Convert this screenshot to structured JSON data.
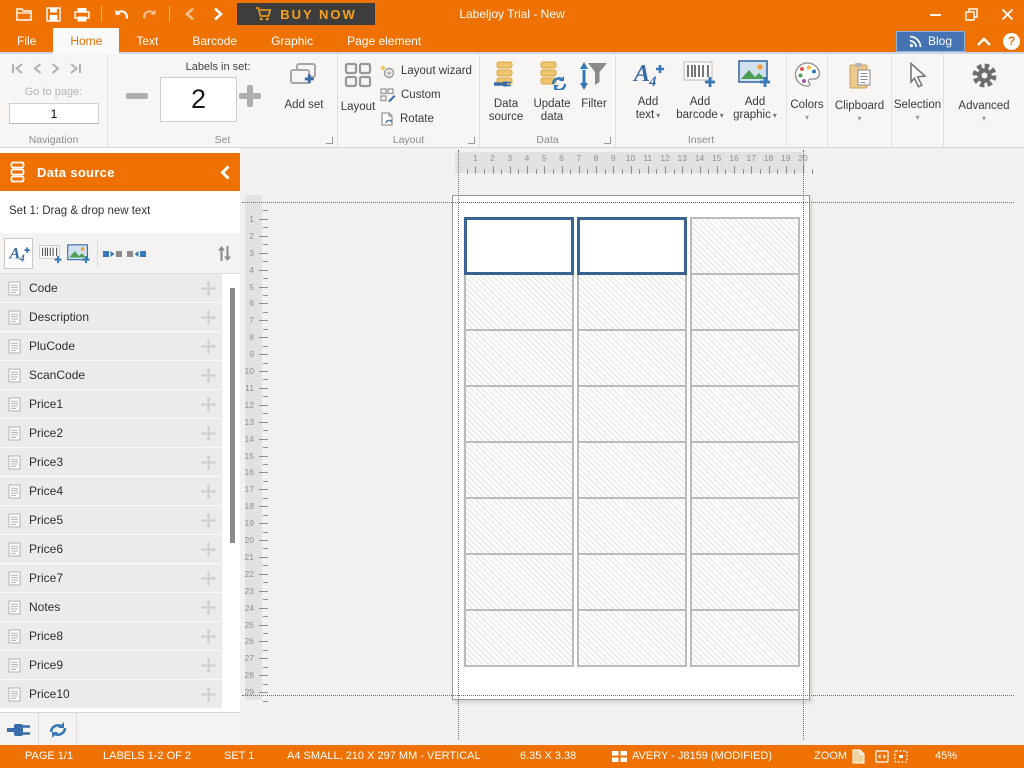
{
  "colors": {
    "accent_orange": "#ee7102",
    "selection_blue": "#3a648f",
    "buy_now_gold": "#f5a11c",
    "blog_blue": "#4573b3"
  },
  "titlebar": {
    "title": "Labeljoy Trial - New",
    "buy_now": "BUY NOW"
  },
  "menubar": {
    "tabs": [
      {
        "label": "File",
        "active": false
      },
      {
        "label": "Home",
        "active": true
      },
      {
        "label": "Text",
        "active": false
      },
      {
        "label": "Barcode",
        "active": false
      },
      {
        "label": "Graphic",
        "active": false
      },
      {
        "label": "Page element",
        "active": false
      }
    ],
    "blog_label": "Blog"
  },
  "ribbon": {
    "navigation": {
      "goto_label": "Go to page:",
      "page_value": "1",
      "group_label": "Navigation"
    },
    "set": {
      "field_label": "Labels in set:",
      "value": "2",
      "add_set_label": "Add set",
      "group_label": "Set"
    },
    "layout": {
      "main_label": "Layout",
      "wizard_label": "Layout wizard",
      "custom_label": "Custom",
      "rotate_label": "Rotate",
      "group_label": "Layout"
    },
    "data": {
      "source_label": "Data source",
      "update_label": "Update data",
      "filter_label": "Filter",
      "group_label": "Data"
    },
    "insert": {
      "text_label": "Add text",
      "barcode_label": "Add barcode",
      "graphic_label": "Add graphic",
      "group_label": "Insert"
    },
    "tools": {
      "colors_label": "Colors",
      "clipboard_label": "Clipboard",
      "selection_label": "Selection",
      "advanced_label": "Advanced"
    }
  },
  "sidebar": {
    "header": "Data source",
    "hint": "Set 1: Drag & drop new text",
    "fields": [
      "Code",
      "Description",
      "PluCode",
      "ScanCode",
      "Price1",
      "Price2",
      "Price3",
      "Price4",
      "Price5",
      "Price6",
      "Price7",
      "Notes",
      "Price8",
      "Price9",
      "Price10"
    ]
  },
  "canvas": {
    "h_ruler": {
      "start": 1,
      "end": 20
    },
    "v_ruler": {
      "start": 1,
      "end": 29
    },
    "grid": {
      "columns": 3,
      "rows": 8,
      "selected_cells": [
        [
          0,
          0
        ],
        [
          0,
          1
        ]
      ]
    }
  },
  "statusbar": {
    "page": "PAGE 1/1",
    "labels": "LABELS 1-2 OF 2",
    "set": "SET 1",
    "format": "A4 SMALL, 210 X 297 MM - VERTICAL",
    "size": "6.35 X 3.38",
    "template": "AVERY - J8159 (MODIFIED)",
    "zoom_label": "ZOOM",
    "zoom_value": "45%"
  }
}
